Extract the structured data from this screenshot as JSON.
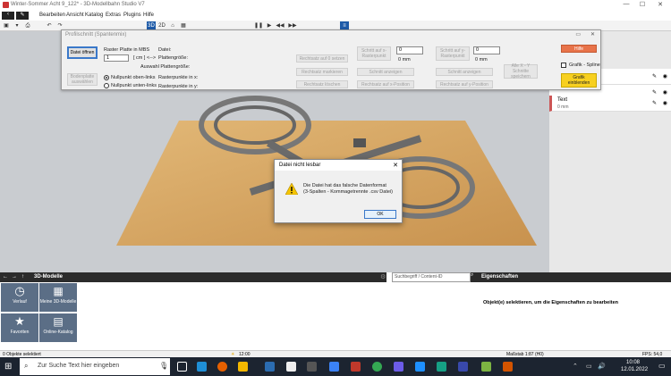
{
  "app": {
    "title": "Winter-Sommer Acht 9_122* - 3D-Modellbahn Studio V7",
    "menu": [
      "Bearbeiten",
      "Ansicht",
      "Katalog",
      "Extras",
      "Plugins",
      "Hilfe"
    ],
    "toolbar_3d": "3D",
    "toolbar_2d": "2D"
  },
  "profile_dialog": {
    "title": "Profilschnitt (Spantenmix)",
    "open_file": "Datei öffnen",
    "raster_label": "Raster Platte in MBS",
    "raster_value": "1",
    "unit": "[ cm ] <-->",
    "file_label": "Datei:",
    "plate_size_label": "Plattengröße:",
    "selection_plate_label": "Auswahl Plattengröße:",
    "raster_x_label": "Rasterpunkte in x:",
    "raster_y_label": "Rasterpunkte in y:",
    "plate_select_btn": "Bodenplatte auswählen",
    "radio_top": "Nullpunkt oben-links",
    "radio_bottom": "Nullpunkt unten-links",
    "btn_lineal_setzen": "Rechtsatz auf 0 setzen",
    "btn_lineal_markieren": "Rechtsatz markieren",
    "btn_lineal_loeschen": "Rechtsatz löschen",
    "btn_schritt_x": "Schritt auf x-Rasterpunkt",
    "btn_schnitt_anzeigen": "Schnitt anzeigen",
    "btn_lineal_positionen": "Rechtsatz auf x-Position",
    "btn_schritt_y": "Schritt auf y-Rasterpunkt",
    "btn_schnitt_anzeigen2": "Schnitt anzeigen",
    "btn_lineal_positionen2": "Rechtsatz auf y-Position",
    "spin1": "0",
    "spin1_unit": "0 mm",
    "spin2": "0",
    "spin2_unit": "0 mm",
    "btn_alle_schnitte": "Alle X - Y Schnitte speichern",
    "help": "Hilfe",
    "spline_label": "Grafik - Spline",
    "grafik_btn": "Grafik einblenden"
  },
  "right_panel": {
    "text_item": "Text",
    "text_value": "0 mm"
  },
  "message_box": {
    "title": "Datei nicht lesbar",
    "line1": "Die Datei hat das falsche Datenformat",
    "line2": "(3-Spalten - Kommagetrennte .csv Datei)",
    "ok": "OK"
  },
  "models_panel": {
    "header": "3D-Modelle",
    "search_placeholder": "Suchbegriff / Content-ID",
    "tiles": [
      "Verlauf",
      "Meine 3D-Modelle",
      "Favoriten",
      "Online-Katalog"
    ]
  },
  "properties_panel": {
    "header": "Eigenschaften",
    "hint": "Objekt(e) selektieren, um die Eigenschaften zu bearbeiten"
  },
  "status": {
    "selected": "0 Objekte selektiert",
    "time": "12:00",
    "scale": "Maßstab 1:87 (H0)",
    "fps": "FPS: 54,0"
  },
  "taskbar": {
    "search": "Zur Suche Text hier eingeben",
    "clock": "10:08",
    "date": "12.01.2022"
  },
  "colors": {
    "help_btn": "#e8734a",
    "grafik_btn": "#f7d020",
    "warn": "#f5c400"
  }
}
